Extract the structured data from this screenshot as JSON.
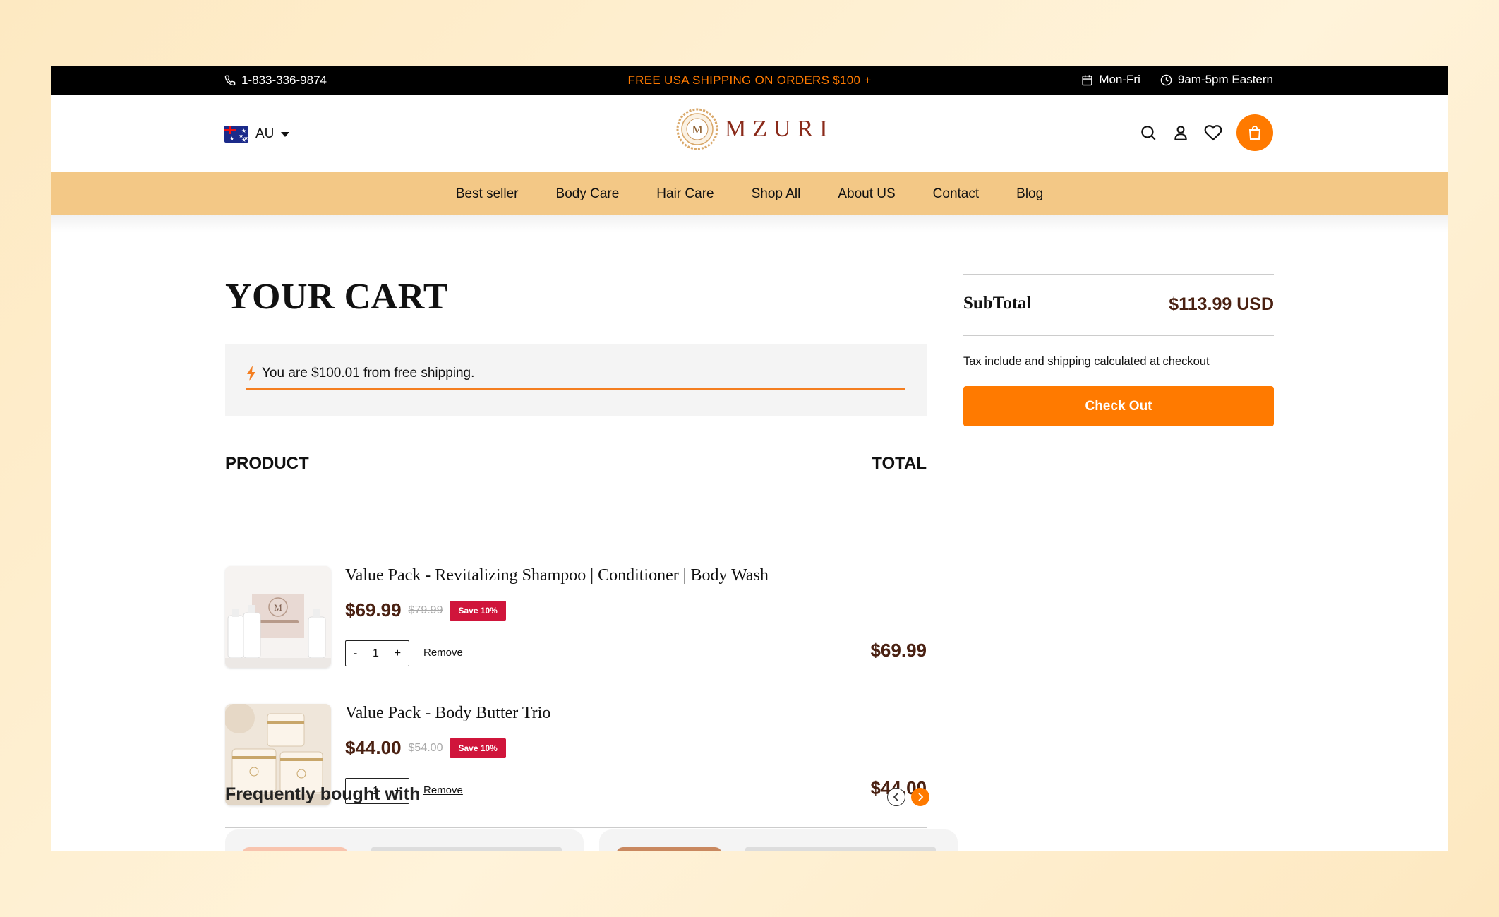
{
  "topbar": {
    "phone": "1-833-336-9874",
    "promo": "FREE USA SHIPPING ON ORDERS $100 +",
    "days": "Mon-Fri",
    "hours": "9am-5pm Eastern"
  },
  "header": {
    "region": "AU",
    "logo_text": "MZURI",
    "logo_initial": "M"
  },
  "nav": {
    "items": [
      "Best seller",
      "Body Care",
      "Hair Care",
      "Shop All",
      "About US",
      "Contact",
      "Blog"
    ]
  },
  "cart": {
    "title": "YOUR CART",
    "shipping_msg": "You are $100.01 from free shipping.",
    "col_product": "PRODUCT",
    "col_total": "TOTAL",
    "remove_label": "Remove",
    "items": [
      {
        "name": "Value Pack - Revitalizing Shampoo | Conditioner | Body Wash",
        "price": "$69.99",
        "compare_price": "$79.99",
        "badge": "Save 10%",
        "qty": "1",
        "line_total": "$69.99"
      },
      {
        "name": "Value Pack - Body Butter Trio",
        "price": "$44.00",
        "compare_price": "$54.00",
        "badge": "Save 10%",
        "qty": "1",
        "line_total": "$44.00"
      }
    ]
  },
  "frequently": {
    "title": "Frequently bought with"
  },
  "summary": {
    "subtotal_label": "SubTotal",
    "subtotal_value": "$113.99 USD",
    "tax_note": "Tax include and shipping calculated at checkout",
    "checkout_label": "Check Out"
  },
  "icons": [
    "phone-icon",
    "calendar-icon",
    "clock-icon",
    "search-icon",
    "user-icon",
    "heart-icon",
    "shopping-bag-icon",
    "lightning-icon",
    "chevron-left-icon",
    "chevron-right-icon"
  ],
  "colors": {
    "accent": "#ff7a00",
    "nav_bg": "#f3c886",
    "price": "#4a2112",
    "badge": "#d0153b"
  }
}
